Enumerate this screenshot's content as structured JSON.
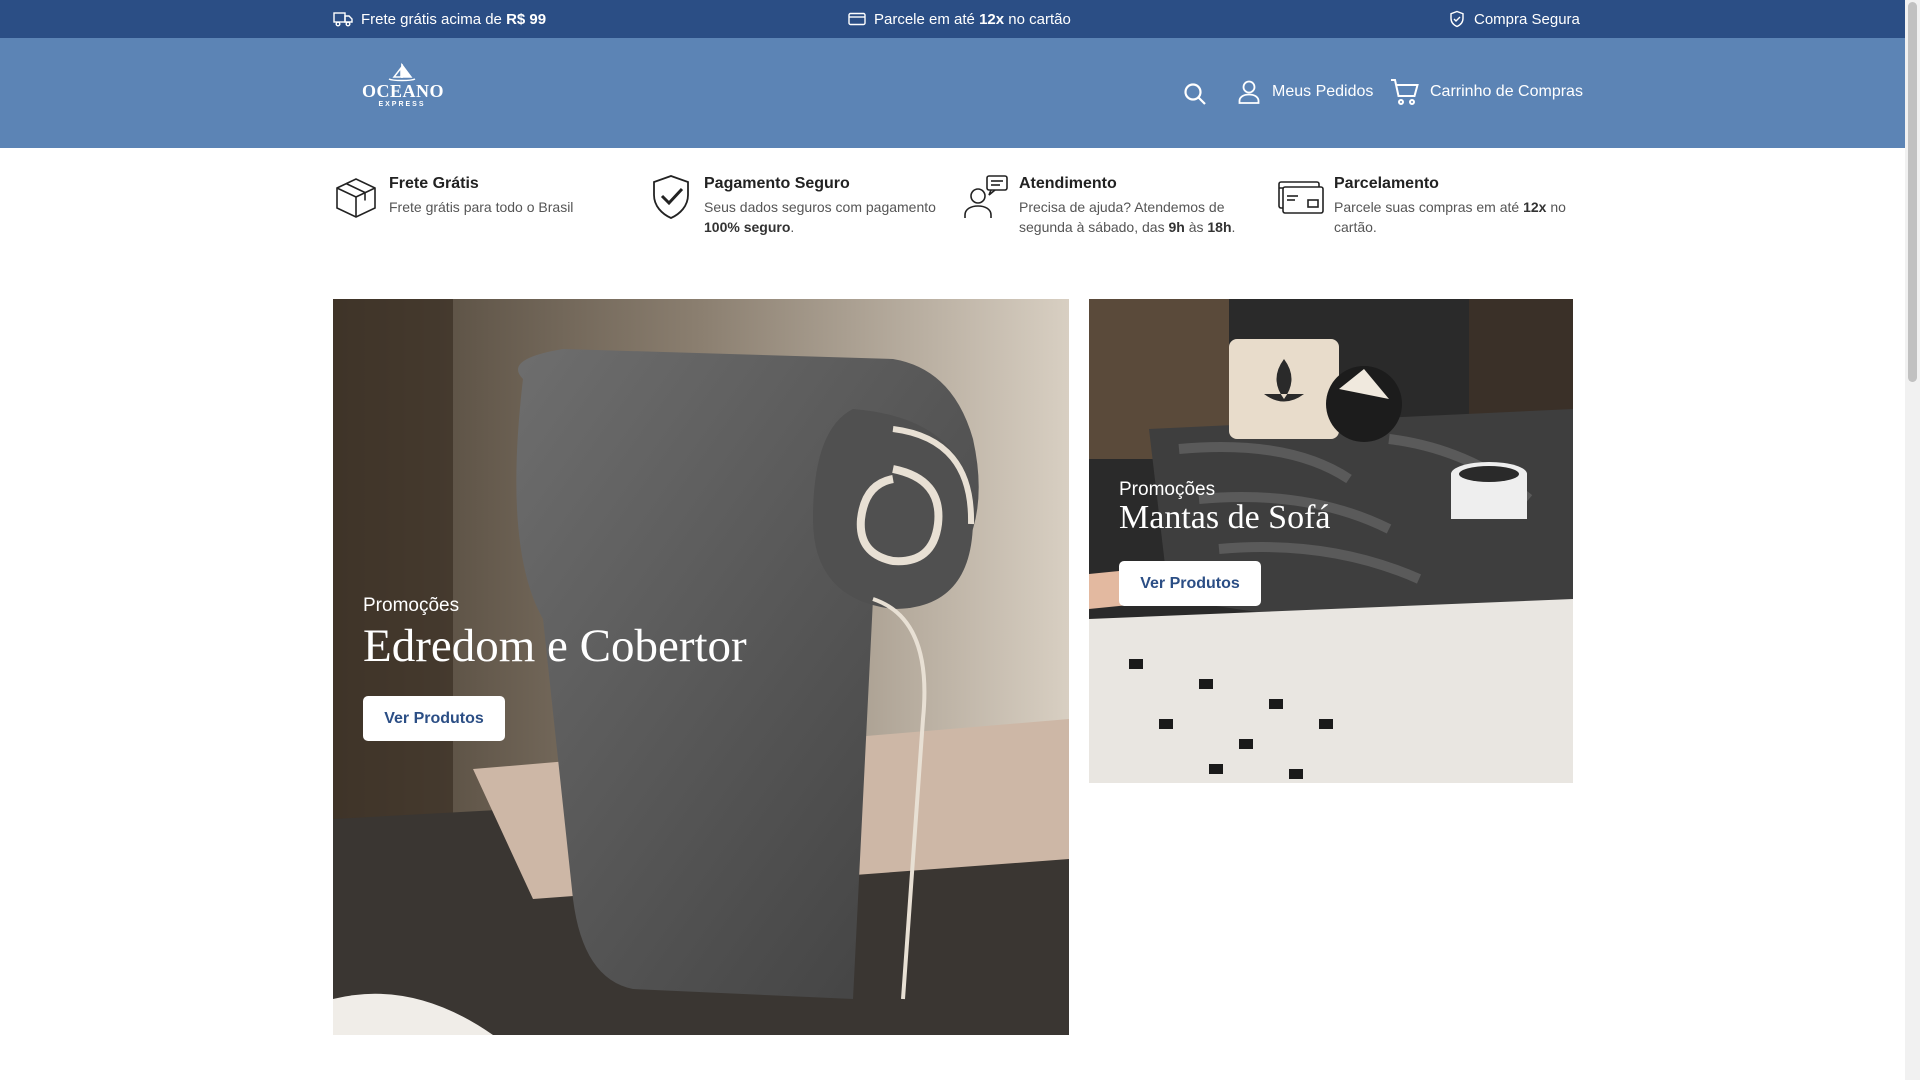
{
  "topbar": {
    "shipping": {
      "prefix": "Frete grátis acima de",
      "value": "R$ 99"
    },
    "installments": {
      "prefix": "Parcele em até",
      "value": "12x",
      "suffix": "no cartão"
    },
    "secure": "Compra Segura"
  },
  "header": {
    "logo": {
      "name": "OCEANO",
      "sub": "EXPRESS"
    },
    "orders_label": "Meus Pedidos",
    "cart_label": "Carrinho de Compras"
  },
  "benefits": [
    {
      "title": "Frete Grátis",
      "desc": "Frete grátis para todo o Brasil",
      "icon": "box-icon"
    },
    {
      "title": "Pagamento Seguro",
      "desc_a": "Seus dados seguros com pagamento",
      "desc_b": "100% seguro",
      "desc_c": ".",
      "icon": "shield-check-icon"
    },
    {
      "title": "Atendimento",
      "desc_a": "Precisa de ajuda? Atendemos de segunda à sábado, das",
      "desc_b": "9h",
      "desc_c": "às",
      "desc_d": "18h",
      "desc_e": ".",
      "icon": "support-icon"
    },
    {
      "title": "Parcelamento",
      "desc_a": "Parcele suas compras em até",
      "desc_b": "12x",
      "desc_c": "no cartão.",
      "icon": "card-icon"
    }
  ],
  "banners": {
    "main": {
      "kicker": "Promoções",
      "headline": "Edredom e Cobertor",
      "cta": "Ver Produtos"
    },
    "side": {
      "kicker": "Promoções",
      "headline": "Mantas de Sofá",
      "cta": "Ver Produtos"
    }
  },
  "colors": {
    "topbar": "#2b4e85",
    "header": "#5c84b5",
    "accent": "#2b4e85"
  }
}
